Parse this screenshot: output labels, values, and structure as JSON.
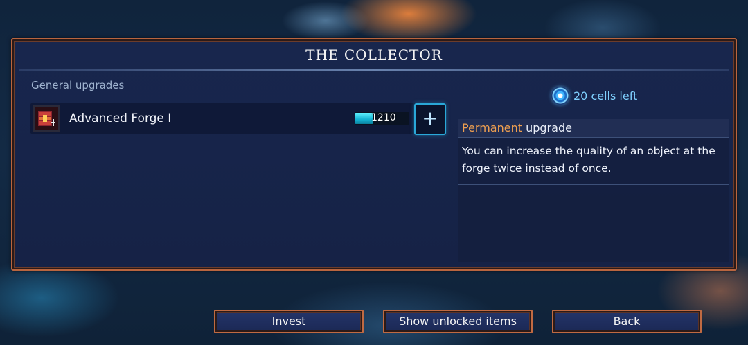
{
  "window": {
    "title": "THE COLLECTOR"
  },
  "section": {
    "label": "General upgrades"
  },
  "upgrades": [
    {
      "name": "Advanced Forge I",
      "icon": "advanced-forge-icon",
      "cost": "1210",
      "cost_progress_percent": 35
    }
  ],
  "plus_button": {
    "label": "+"
  },
  "cells": {
    "text": "20 cells left",
    "icon": "cell-icon"
  },
  "description": {
    "head_prefix": "Permanent",
    "head_suffix": " upgrade",
    "body": "You can increase the quality of an object at the forge twice instead of once."
  },
  "buttons": {
    "invest": "Invest",
    "show_unlocked": "Show unlocked items",
    "back": "Back"
  },
  "colors": {
    "accent_cyan": "#2aa8d8",
    "permanent_orange": "#f0a050",
    "frame_copper": "#b9653f",
    "cells_text": "#7fd0ff"
  }
}
